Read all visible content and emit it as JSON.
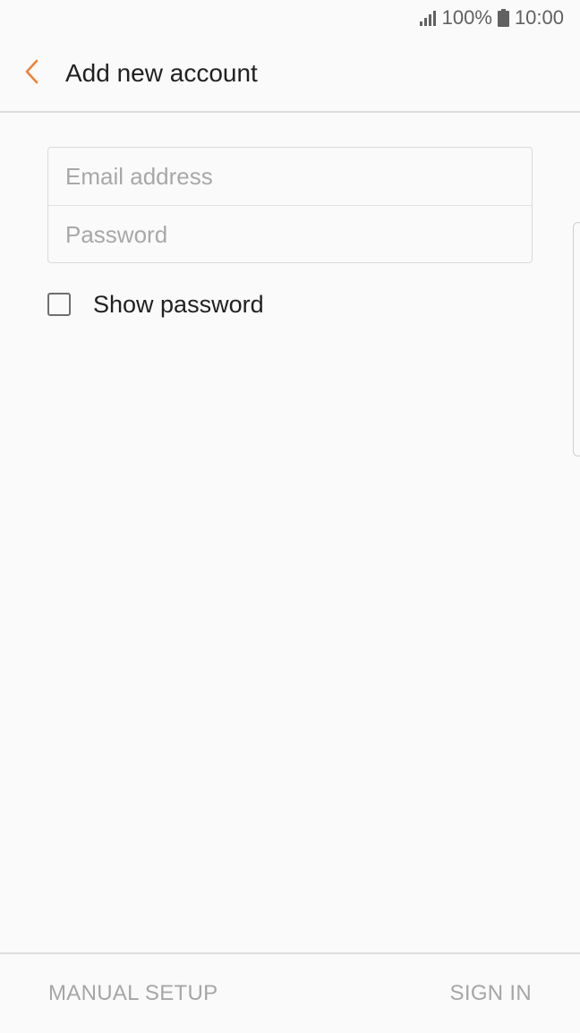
{
  "status_bar": {
    "battery_percent": "100%",
    "time": "10:00",
    "icons": [
      "signal-icon",
      "battery-icon"
    ]
  },
  "header": {
    "title": "Add new account",
    "back_icon": "chevron-left-icon"
  },
  "form": {
    "email_placeholder": "Email address",
    "email_value": "",
    "password_placeholder": "Password",
    "password_value": ""
  },
  "show_password": {
    "label": "Show password",
    "checked": false
  },
  "footer": {
    "manual_setup_label": "MANUAL SETUP",
    "sign_in_label": "SIGN IN"
  },
  "colors": {
    "accent": "#f0813c",
    "background": "#fafafa",
    "disabled_text": "#a6a6a6"
  }
}
